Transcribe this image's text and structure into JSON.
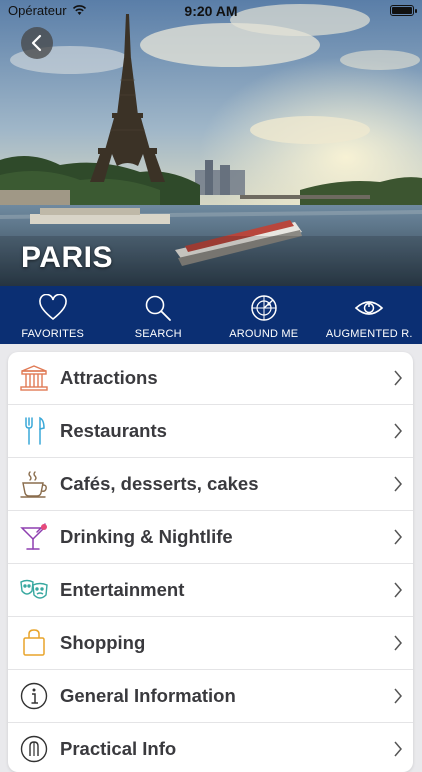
{
  "status_bar": {
    "carrier": "Opérateur",
    "time": "9:20 AM"
  },
  "hero": {
    "city": "PARIS"
  },
  "nav_tabs": [
    {
      "label": "FAVORITES",
      "icon": "heart-icon"
    },
    {
      "label": "SEARCH",
      "icon": "search-icon"
    },
    {
      "label": "AROUND ME",
      "icon": "radar-icon"
    },
    {
      "label": "AUGMENTED R.",
      "icon": "eye-icon"
    }
  ],
  "menu": [
    {
      "label": "Attractions",
      "icon": "monument-icon",
      "color": "#e07a55"
    },
    {
      "label": "Restaurants",
      "icon": "fork-knife-icon",
      "color": "#3aa8d8"
    },
    {
      "label": "Cafés, desserts, cakes",
      "icon": "coffee-cup-icon",
      "color": "#8a6d4d"
    },
    {
      "label": "Drinking & Nightlife",
      "icon": "cocktail-icon",
      "color": "#8e3fb0"
    },
    {
      "label": "Entertainment",
      "icon": "theater-masks-icon",
      "color": "#38a8a0"
    },
    {
      "label": "Shopping",
      "icon": "shopping-bag-icon",
      "color": "#e8a42a"
    },
    {
      "label": "General Information",
      "icon": "info-icon",
      "color": "#333333"
    },
    {
      "label": "Practical Info",
      "icon": "practical-icon",
      "color": "#333333"
    }
  ],
  "colors": {
    "navbar": "#0b2f73",
    "background": "#e9e9ec"
  }
}
